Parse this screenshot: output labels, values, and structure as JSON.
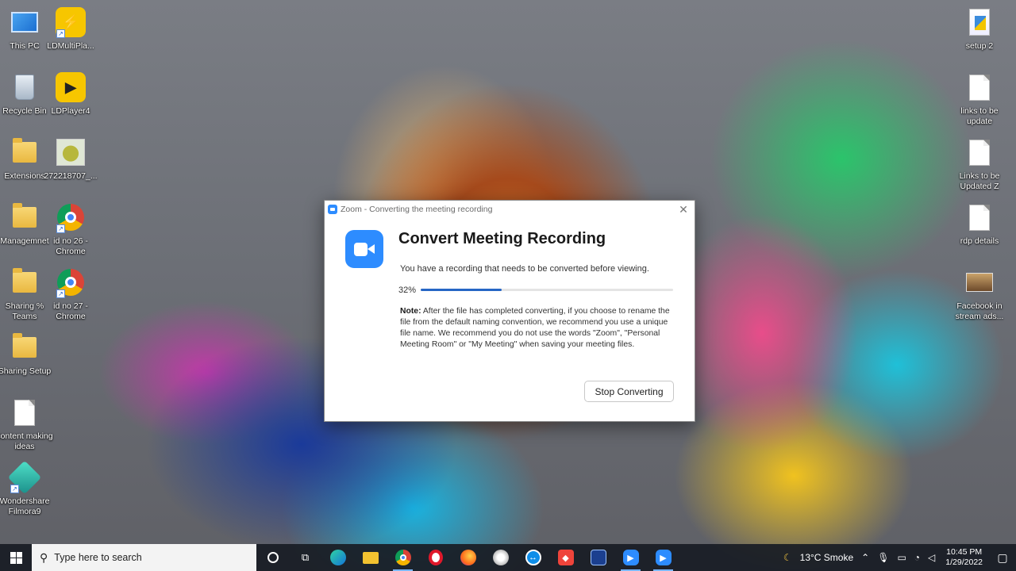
{
  "desktop": {
    "left_icons": [
      {
        "label": "This PC",
        "icon": "this-pc-icon"
      },
      {
        "label": "LDMultiPla...",
        "icon": "ldmultiplayer-icon"
      },
      {
        "label": "Recycle Bin",
        "icon": "recycle-bin-icon"
      },
      {
        "label": "LDPlayer4",
        "icon": "ldplayer-icon"
      },
      {
        "label": "Extensions",
        "icon": "folder-icon"
      },
      {
        "label": "272218707_...",
        "icon": "image-thumbnail-icon"
      },
      {
        "label": "Managemnet",
        "icon": "folder-icon"
      },
      {
        "label": "id no 26 - Chrome",
        "icon": "chrome-icon"
      },
      {
        "label": "Sharing % Teams",
        "icon": "folder-icon"
      },
      {
        "label": "id no 27 - Chrome",
        "icon": "chrome-icon"
      },
      {
        "label": "Sharing Setup",
        "icon": "folder-icon"
      },
      {
        "label": "content making ideas",
        "icon": "document-icon"
      },
      {
        "label": "Wondershare Filmora9",
        "icon": "filmora-icon"
      }
    ],
    "right_icons": [
      {
        "label": "setup 2",
        "icon": "setup-file-icon"
      },
      {
        "label": "links to be update",
        "icon": "document-icon"
      },
      {
        "label": "Links to be Updated Z",
        "icon": "document-icon"
      },
      {
        "label": "rdp details",
        "icon": "document-icon"
      },
      {
        "label": "Facebook in stream ads...",
        "icon": "image-thumbnail-icon"
      }
    ]
  },
  "dialog": {
    "window_title": "Zoom - Converting the meeting recording",
    "close_symbol": "✕",
    "heading": "Convert Meeting Recording",
    "subtext": "You have a recording that needs to be converted before viewing.",
    "progress_label": "32%",
    "progress_value": 0.32,
    "note_label": "Note:",
    "note_text": " After the file has completed converting, if you choose to rename the file from the default naming convention, we recommend you use a unique file name. We recommend you do not use the words \"Zoom\", \"Personal Meeting Room\" or \"My Meeting\" when saving your meeting files.",
    "stop_button": "Stop Converting",
    "accent_color": "#2d8cff"
  },
  "taskbar": {
    "search_placeholder": "Type here to search",
    "apps": [
      "task-view",
      "edge",
      "file-explorer",
      "chrome",
      "opera",
      "firefox",
      "paint",
      "teamviewer",
      "anydesk",
      "network-app",
      "zoom",
      "zoom"
    ],
    "weather": "13°C  Smoke",
    "time": "10:45 PM",
    "date": "1/29/2022"
  }
}
